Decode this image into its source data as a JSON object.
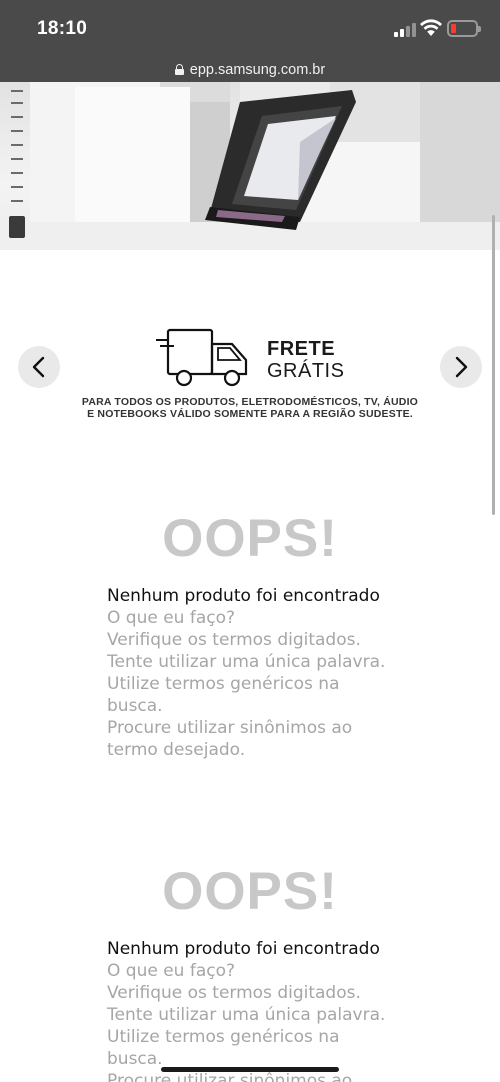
{
  "status_bar": {
    "time": "18:10",
    "battery_color": "#ff3b30"
  },
  "browser": {
    "url": "epp.samsung.com.br"
  },
  "banner": {
    "image": "phone-with-flip-cover-product-photo"
  },
  "promo": {
    "title_line1": "FRETE",
    "title_line2": "GRÁTIS",
    "text_line1": "PARA TODOS OS PRODUTOS, ELETRODOMÉSTICOS, TV, ÁUDIO",
    "text_line2": "E NOTEBOOKS VÁLIDO SOMENTE PARA A REGIÃO SUDESTE.",
    "prev_icon": "chevron-left-icon",
    "next_icon": "chevron-right-icon",
    "illustration": "delivery-truck-icon"
  },
  "results": [
    {
      "oops": "OOPS!",
      "headline": "Nenhum produto foi encontrado",
      "lines": [
        "O que eu faço?",
        "Verifique os termos digitados.",
        "Tente utilizar uma única palavra.",
        "Utilize termos genéricos na",
        "busca.",
        "Procure utilizar sinônimos ao",
        "termo desejado."
      ]
    },
    {
      "oops": "OOPS!",
      "headline": "Nenhum produto foi encontrado",
      "lines": [
        "O que eu faço?",
        "Verifique os termos digitados.",
        "Tente utilizar uma única palavra.",
        "Utilize termos genéricos na",
        "busca.",
        "Procure utilizar sinônimos ao"
      ]
    }
  ]
}
